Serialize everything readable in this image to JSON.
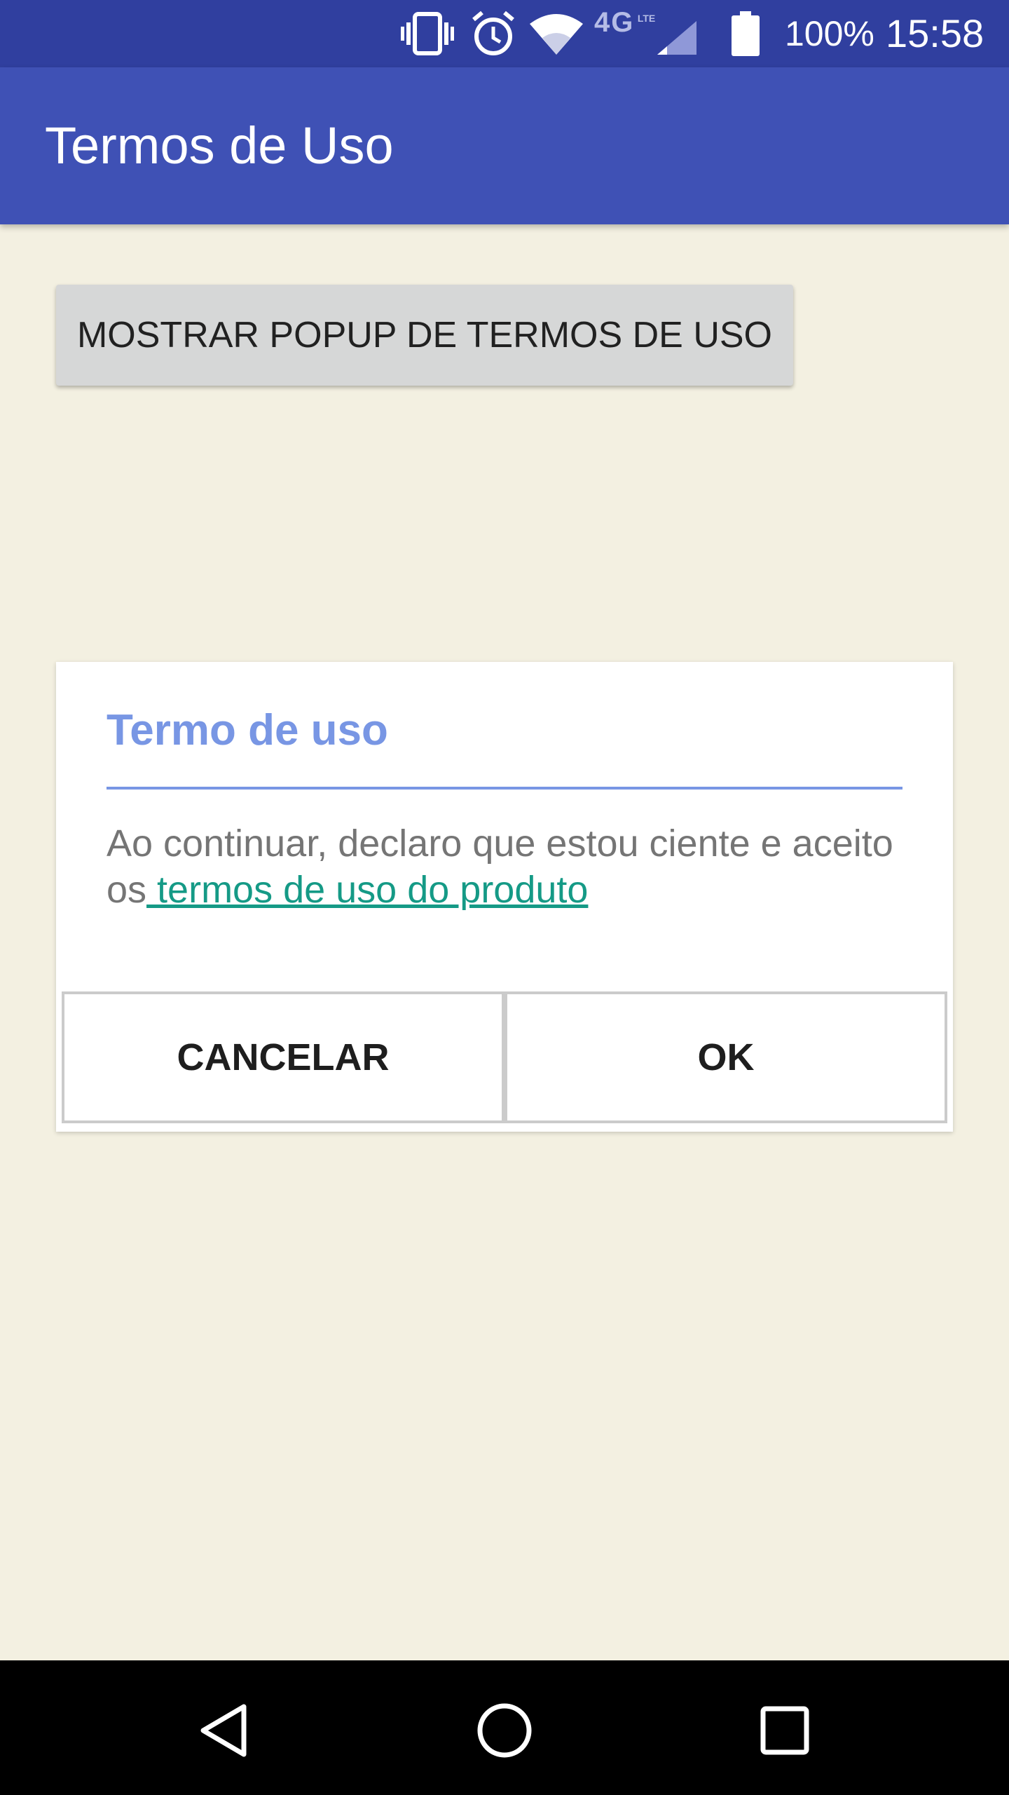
{
  "status_bar": {
    "icons": [
      "vibrate-icon",
      "alarm-icon",
      "wifi-icon",
      "4g-lte-icon",
      "cellular-signal-icon",
      "battery-icon"
    ],
    "network_label": "4G",
    "battery_percent": "100%",
    "time": "15:58"
  },
  "app_bar": {
    "title": "Termos de Uso"
  },
  "main": {
    "show_popup_button_label": "MOSTRAR POPUP DE TERMOS DE USO"
  },
  "dialog": {
    "title": "Termo de uso",
    "message_prefix": "Ao continuar, declaro que estou ciente e aceito os",
    "link_text": " termos de uso do produto",
    "cancel_label": "CANCELAR",
    "ok_label": "OK"
  },
  "nav_bar": {
    "icons": [
      "back-icon",
      "home-icon",
      "recents-icon"
    ]
  },
  "colors": {
    "status_bar": "#303f9f",
    "app_bar": "#3f51b5",
    "background": "#f3f0e1",
    "dialog_accent": "#7896e4",
    "link": "#159a86"
  }
}
